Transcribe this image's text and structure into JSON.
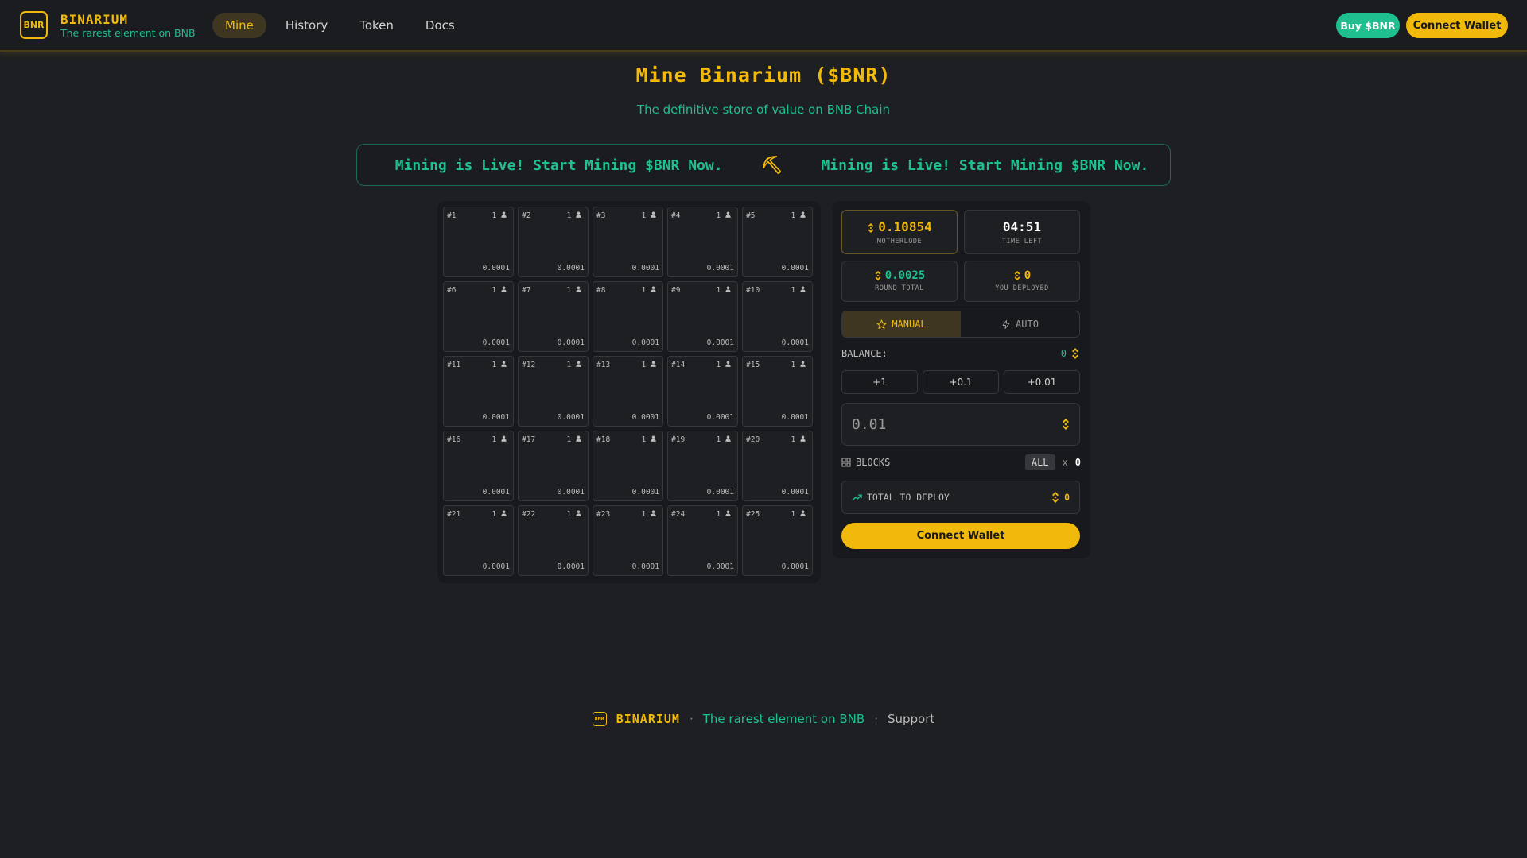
{
  "header": {
    "logo_text": "BNR",
    "brand": "BINARIUM",
    "tagline": "The rarest element on BNB",
    "nav": [
      {
        "label": "Mine",
        "active": true
      },
      {
        "label": "History",
        "active": false
      },
      {
        "label": "Token",
        "active": false
      },
      {
        "label": "Docs",
        "active": false
      }
    ],
    "buy_label": "Buy $BNR",
    "connect_label": "Connect Wallet"
  },
  "hero": {
    "title": "Mine Binarium ($BNR)",
    "subtitle": "The definitive store of value on BNB Chain"
  },
  "ticker": {
    "text": "Mining is Live! Start Mining $BNR Now.",
    "icon": "pickaxe-icon"
  },
  "grid": {
    "blocks": [
      {
        "id": "#1",
        "miners": "1",
        "amount": "0.0001"
      },
      {
        "id": "#2",
        "miners": "1",
        "amount": "0.0001"
      },
      {
        "id": "#3",
        "miners": "1",
        "amount": "0.0001"
      },
      {
        "id": "#4",
        "miners": "1",
        "amount": "0.0001"
      },
      {
        "id": "#5",
        "miners": "1",
        "amount": "0.0001"
      },
      {
        "id": "#6",
        "miners": "1",
        "amount": "0.0001"
      },
      {
        "id": "#7",
        "miners": "1",
        "amount": "0.0001"
      },
      {
        "id": "#8",
        "miners": "1",
        "amount": "0.0001"
      },
      {
        "id": "#9",
        "miners": "1",
        "amount": "0.0001"
      },
      {
        "id": "#10",
        "miners": "1",
        "amount": "0.0001"
      },
      {
        "id": "#11",
        "miners": "1",
        "amount": "0.0001"
      },
      {
        "id": "#12",
        "miners": "1",
        "amount": "0.0001"
      },
      {
        "id": "#13",
        "miners": "1",
        "amount": "0.0001"
      },
      {
        "id": "#14",
        "miners": "1",
        "amount": "0.0001"
      },
      {
        "id": "#15",
        "miners": "1",
        "amount": "0.0001"
      },
      {
        "id": "#16",
        "miners": "1",
        "amount": "0.0001"
      },
      {
        "id": "#17",
        "miners": "1",
        "amount": "0.0001"
      },
      {
        "id": "#18",
        "miners": "1",
        "amount": "0.0001"
      },
      {
        "id": "#19",
        "miners": "1",
        "amount": "0.0001"
      },
      {
        "id": "#20",
        "miners": "1",
        "amount": "0.0001"
      },
      {
        "id": "#21",
        "miners": "1",
        "amount": "0.0001"
      },
      {
        "id": "#22",
        "miners": "1",
        "amount": "0.0001"
      },
      {
        "id": "#23",
        "miners": "1",
        "amount": "0.0001"
      },
      {
        "id": "#24",
        "miners": "1",
        "amount": "0.0001"
      },
      {
        "id": "#25",
        "miners": "1",
        "amount": "0.0001"
      }
    ]
  },
  "panel": {
    "motherlode": {
      "value": "0.10854",
      "label": "MOTHERLODE"
    },
    "time_left": {
      "value": "04:51",
      "label": "TIME LEFT"
    },
    "round_total": {
      "value": "0.0025",
      "label": "ROUND TOTAL"
    },
    "you_deployed": {
      "value": "0",
      "label": "YOU DEPLOYED"
    },
    "modes": {
      "manual": "MANUAL",
      "auto": "AUTO",
      "selected": "manual"
    },
    "balance_label": "BALANCE:",
    "balance_value": "0",
    "increments": [
      "+1",
      "+0.1",
      "+0.01"
    ],
    "amount_placeholder": "0.01",
    "blocks_label": "BLOCKS",
    "all_label": "ALL",
    "times": "x",
    "blocks_count": "0",
    "total_label": "TOTAL TO DEPLOY",
    "total_value": "0",
    "connect_label": "Connect Wallet"
  },
  "footer": {
    "logo_text": "BNR",
    "brand": "BINARIUM",
    "sep": "·",
    "tagline": "The rarest element on BNB",
    "support": "Support"
  },
  "colors": {
    "background": "#1e1f22",
    "accent_gold": "#f0b90b",
    "accent_green": "#1fbf8f"
  }
}
